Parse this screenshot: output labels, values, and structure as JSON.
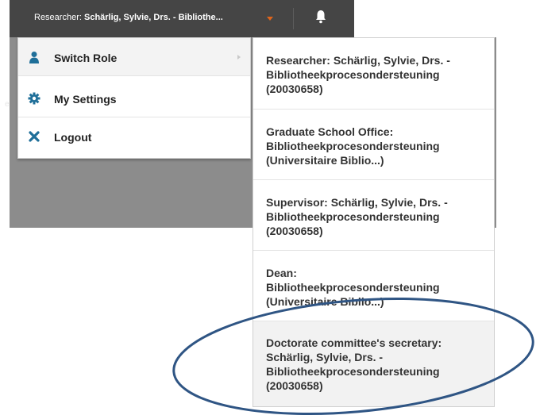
{
  "topbar": {
    "user_prefix": "Researcher:",
    "user_name": "Schärlig, Sylvie, Drs. - Bibliothe...",
    "caret_color": "#e0651b"
  },
  "background_fragment": "e",
  "menu": {
    "items": [
      {
        "label": "Switch Role",
        "icon": "user-icon",
        "icon_color": "#1f6f99"
      },
      {
        "label": "My Settings",
        "icon": "gear-icon",
        "icon_color": "#1f6f99"
      },
      {
        "label": "Logout",
        "icon": "close-icon",
        "icon_color": "#1f6f99"
      }
    ]
  },
  "roles": [
    {
      "text": "Researcher: Schärlig, Sylvie, Drs. -\nBibliotheekprocesondersteuning\n(20030658)"
    },
    {
      "text": "Graduate School Office:\nBibliotheekprocesondersteuning\n(Universitaire Biblio...)"
    },
    {
      "text": "Supervisor: Schärlig, Sylvie, Drs. -\nBibliotheekprocesondersteuning\n(20030658)"
    },
    {
      "text": "Dean:\nBibliotheekprocesondersteuning\n(Universitaire Biblio...)"
    },
    {
      "text": "Doctorate committee's secretary:\nSchärlig, Sylvie, Drs. -\nBibliotheekprocesondersteuning\n(20030658)"
    }
  ],
  "annotation_color": "#2f5584"
}
